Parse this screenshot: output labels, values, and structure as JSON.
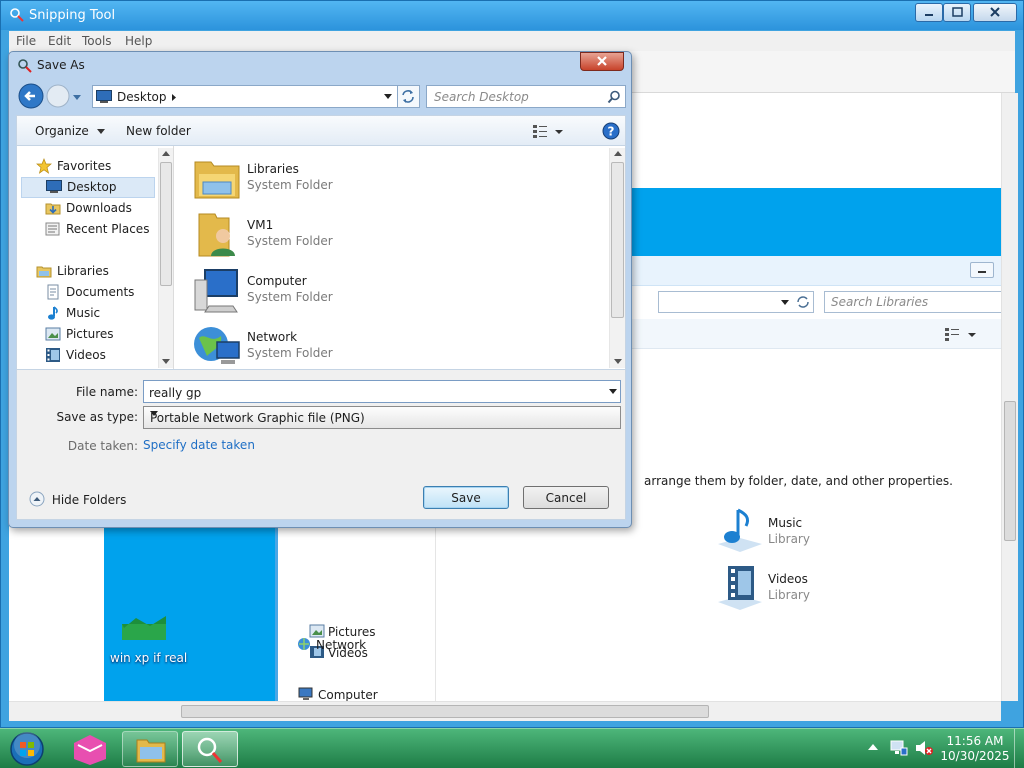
{
  "snipping_tool": {
    "title": "Snipping Tool",
    "menu": [
      "File",
      "Edit",
      "Tools",
      "Help"
    ]
  },
  "captured": {
    "search_placeholder": "Search Libraries",
    "arrange_text": "arrange them by folder, date, and other properties.",
    "libraries": [
      {
        "name": "Music",
        "type": "Library"
      },
      {
        "name": "Videos",
        "type": "Library"
      }
    ],
    "nav_items": [
      "Pictures",
      "Videos",
      "Computer",
      "Network"
    ],
    "desktop_icon_label": "win xp if real"
  },
  "dialog": {
    "title": "Save As",
    "address": "Desktop",
    "search_placeholder": "Search Desktop",
    "organize_label": "Organize",
    "new_folder_label": "New folder",
    "nav": {
      "favorites_header": "Favorites",
      "favorites": [
        "Desktop",
        "Downloads",
        "Recent Places"
      ],
      "libraries_header": "Libraries",
      "libraries": [
        "Documents",
        "Music",
        "Pictures",
        "Videos"
      ]
    },
    "files": [
      {
        "name": "Libraries",
        "type": "System Folder"
      },
      {
        "name": "VM1",
        "type": "System Folder"
      },
      {
        "name": "Computer",
        "type": "System Folder"
      },
      {
        "name": "Network",
        "type": "System Folder"
      }
    ],
    "file_name_label": "File name:",
    "file_name_value": "really gp",
    "save_type_label": "Save as type:",
    "save_type_value": "Portable Network Graphic file (PNG)",
    "date_taken_label": "Date taken:",
    "date_taken_link": "Specify date taken",
    "hide_folders_label": "Hide Folders",
    "save_label": "Save",
    "cancel_label": "Cancel"
  },
  "taskbar": {
    "time": "11:56 AM",
    "date": "10/30/2025"
  },
  "colors": {
    "taskbar": "#2a9457",
    "window_frame": "#3fa3e0",
    "accent_blue": "#00a2ed",
    "link": "#1f6fc5"
  }
}
